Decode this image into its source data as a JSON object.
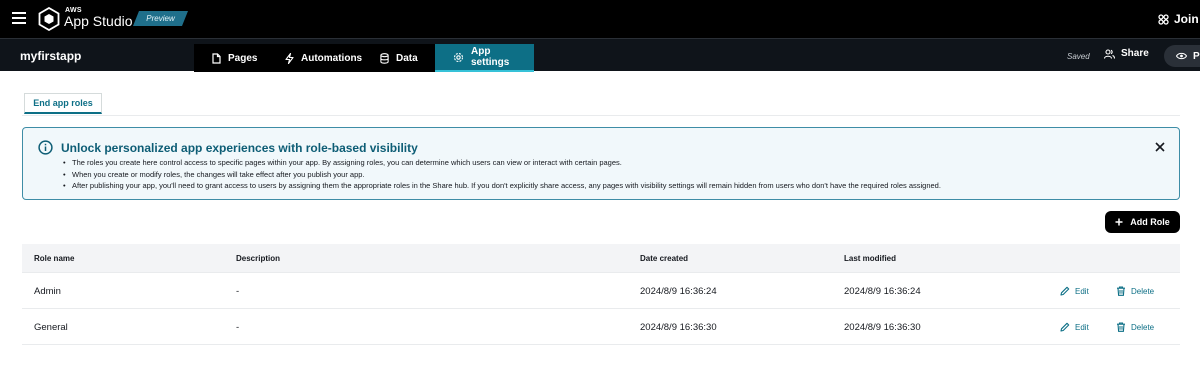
{
  "topbar": {
    "logo_aws": "AWS",
    "logo_name": "App Studio",
    "preview_badge": "Preview",
    "join_label": "Join us"
  },
  "navbar": {
    "app_name": "myfirstapp",
    "tabs": [
      {
        "label": "Pages",
        "icon": "file-icon"
      },
      {
        "label": "Automations",
        "icon": "lightning-icon"
      },
      {
        "label": "Data",
        "icon": "database-icon"
      },
      {
        "label": "App settings",
        "icon": "gear-icon",
        "active": true
      }
    ],
    "saved_label": "Saved",
    "share_label": "Share",
    "preview_label": "Pr"
  },
  "subtabs": [
    {
      "label": "End app roles",
      "active": true
    }
  ],
  "alert": {
    "title": "Unlock personalized app experiences with role-based visibility",
    "bullets": [
      "The roles you create here control access to specific pages within your app. By assigning roles, you can determine which users can view or interact with certain pages.",
      "When you create or modify roles, the changes will take effect after you publish your app.",
      "After publishing your app, you'll need to grant access to users by assigning them the appropriate roles in the Share hub. If you don't explicitly share access, any pages with visibility settings will remain hidden from users who don't have the required roles assigned."
    ]
  },
  "add_role_label": "Add Role",
  "table": {
    "columns": [
      "Role name",
      "Description",
      "Date created",
      "Last modified"
    ],
    "rows": [
      {
        "name": "Admin",
        "description": "-",
        "created": "2024/8/9 16:36:24",
        "modified": "2024/8/9 16:36:24",
        "edit": "Edit",
        "delete": "Delete"
      },
      {
        "name": "General",
        "description": "-",
        "created": "2024/8/9 16:36:30",
        "modified": "2024/8/9 16:36:30",
        "edit": "Edit",
        "delete": "Delete"
      }
    ]
  },
  "colors": {
    "accent": "#0d6f86",
    "topbar_bg": "#000000",
    "navbar_bg": "#0f141a",
    "alert_bg": "#f1f8fb",
    "alert_border": "#3e8da6"
  }
}
